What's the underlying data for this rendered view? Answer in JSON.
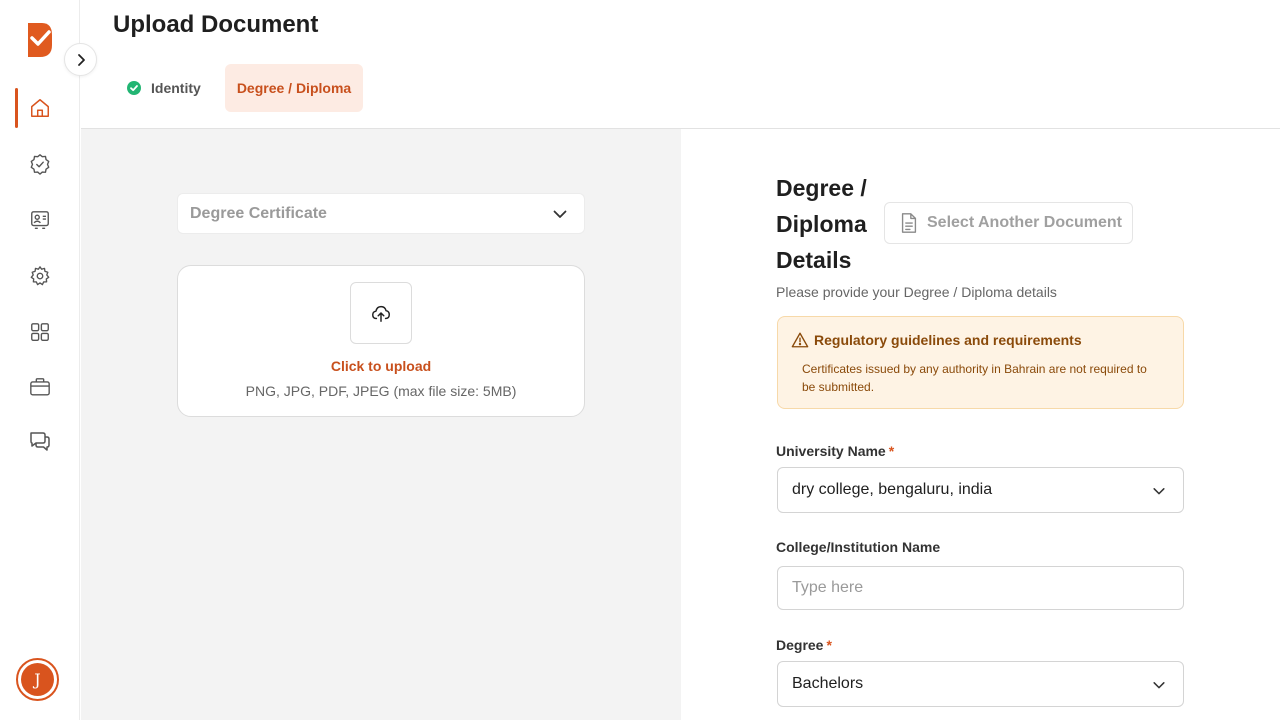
{
  "header": {
    "title": "Upload Document",
    "tabs": [
      {
        "label": "Identity",
        "status": "complete"
      },
      {
        "label": "Degree / Diploma",
        "status": "active"
      }
    ]
  },
  "sidebar": {
    "items": [
      {
        "icon": "home-icon",
        "active": true
      },
      {
        "icon": "verified-badge-icon",
        "active": false
      },
      {
        "icon": "id-card-icon",
        "active": false
      },
      {
        "icon": "gear-icon",
        "active": false
      },
      {
        "icon": "grid-icon",
        "active": false
      },
      {
        "icon": "briefcase-icon",
        "active": false
      },
      {
        "icon": "chat-icon",
        "active": false
      }
    ],
    "user_initial": "J",
    "accent_color": "#d9541e"
  },
  "upload": {
    "document_type": "Degree Certificate",
    "cta": "Click to upload",
    "hint": "PNG, JPG, PDF, JPEG (max file size: 5MB)"
  },
  "details": {
    "title_line1": "Degree /",
    "title_line2": "Diploma",
    "title_line3": "Details",
    "select_another": "Select Another Document",
    "subtitle": "Please provide your Degree / Diploma details",
    "notice": {
      "title": "Regulatory guidelines and requirements",
      "body": "Certificates issued by any authority in Bahrain are not required to be submitted."
    },
    "fields": {
      "university": {
        "label": "University Name",
        "required_mark": "*",
        "value": "dry college, bengaluru, india"
      },
      "college": {
        "label": "College/Institution Name",
        "placeholder": "Type here",
        "value": ""
      },
      "degree": {
        "label": "Degree",
        "required_mark": "*",
        "value": "Bachelors"
      }
    }
  }
}
